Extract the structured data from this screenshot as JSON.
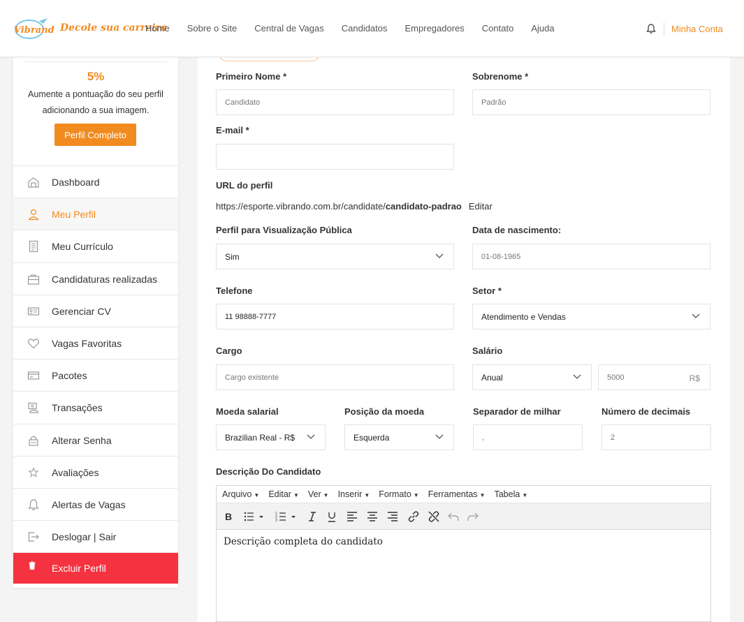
{
  "header": {
    "logo_text": "Decole sua carreira",
    "nav": [
      "Home",
      "Sobre o Site",
      "Central de Vagas",
      "Candidatos",
      "Empregadores",
      "Contato",
      "Ajuda"
    ],
    "account_label": "Minha Conta"
  },
  "sidebar": {
    "percent": "5%",
    "message": "Aumente a pontuação do seu perfil adicionando a sua imagem.",
    "complete_button": "Perfil Completo",
    "items": [
      {
        "label": "Dashboard",
        "icon": "dashboard-icon"
      },
      {
        "label": "Meu Perfil",
        "icon": "user-icon"
      },
      {
        "label": "Meu Currículo",
        "icon": "resume-icon"
      },
      {
        "label": "Candidaturas realizadas",
        "icon": "briefcase-icon"
      },
      {
        "label": "Gerenciar CV",
        "icon": "id-card-icon"
      },
      {
        "label": "Vagas Favoritas",
        "icon": "heart-icon"
      },
      {
        "label": "Pacotes",
        "icon": "package-icon"
      },
      {
        "label": "Transações",
        "icon": "transactions-icon"
      },
      {
        "label": "Alterar Senha",
        "icon": "lock-icon"
      },
      {
        "label": "Avaliações",
        "icon": "star-icon"
      },
      {
        "label": "Alertas de Vagas",
        "icon": "bell-icon"
      },
      {
        "label": "Deslogar | Sair",
        "icon": "logout-icon"
      },
      {
        "label": "Excluir Perfil",
        "icon": "trash-icon"
      }
    ]
  },
  "form": {
    "first_name": {
      "label": "Primeiro Nome *",
      "value": "Candidato"
    },
    "last_name": {
      "label": "Sobrenome *",
      "value": "Padrão"
    },
    "email": {
      "label": "E-mail *",
      "value": ""
    },
    "profile_url": {
      "label": "URL do perfil",
      "prefix": "https://esporte.vibrando.com.br/candidate/",
      "slug": "candidato-padrao",
      "edit": "Editar"
    },
    "public_profile": {
      "label": "Perfil para Visualização Pública",
      "value": "Sim"
    },
    "birth_date": {
      "label": "Data de nascimento:",
      "value": "01-08-1965"
    },
    "phone": {
      "label": "Telefone",
      "value": "11 98888-7777"
    },
    "sector": {
      "label": "Setor *",
      "value": "Atendimento e Vendas"
    },
    "job_title": {
      "label": "Cargo",
      "value": "Cargo existente"
    },
    "salary": {
      "label": "Salário",
      "period": "Anual",
      "amount": "5000",
      "currency_symbol": "R$"
    },
    "currency": {
      "label": "Moeda salarial",
      "value": "Brazilian Real - R$"
    },
    "currency_position": {
      "label": "Posição da moeda",
      "value": "Esquerda"
    },
    "thousand_separator": {
      "label": "Separador de milhar",
      "value": ","
    },
    "decimals": {
      "label": "Número de decimais",
      "value": "2"
    },
    "description": {
      "label": "Descrição Do Candidato",
      "menu": [
        "Arquivo",
        "Editar",
        "Ver",
        "Inserir",
        "Formato",
        "Ferramentas",
        "Tabela"
      ],
      "content": "Descrição completa do candidato"
    }
  },
  "colors": {
    "accent": "#f28b1f",
    "danger": "#f5323f"
  }
}
